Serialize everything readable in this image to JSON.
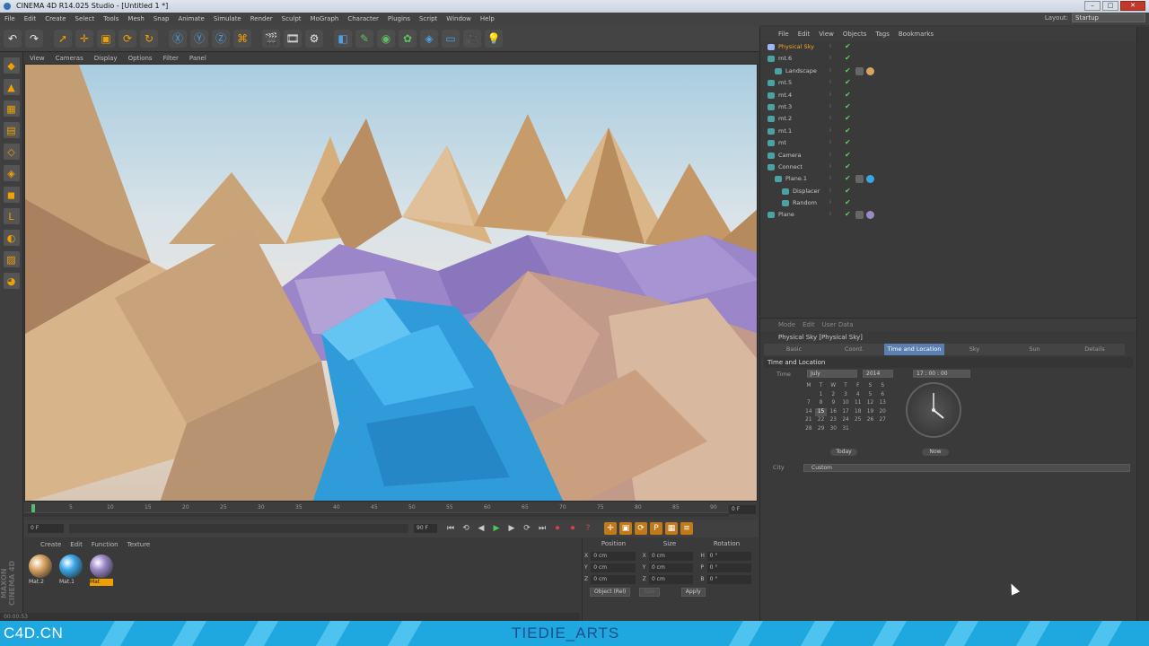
{
  "window": {
    "title": "CINEMA 4D R14.025 Studio - [Untitled 1 *]",
    "min": "–",
    "max": "□",
    "close": "✕"
  },
  "menubar": [
    "File",
    "Edit",
    "Create",
    "Select",
    "Tools",
    "Mesh",
    "Snap",
    "Animate",
    "Simulate",
    "Render",
    "Sculpt",
    "MoGraph",
    "Character",
    "Plugins",
    "Script",
    "Window",
    "Help"
  ],
  "layout": {
    "label": "Layout:",
    "value": "Startup"
  },
  "viewport": {
    "menu": [
      "View",
      "Cameras",
      "Display",
      "Options",
      "Filter",
      "Panel"
    ]
  },
  "timeline": {
    "ticks": [
      "0",
      "5",
      "10",
      "15",
      "20",
      "25",
      "30",
      "35",
      "40",
      "45",
      "50",
      "55",
      "60",
      "65",
      "70",
      "75",
      "80",
      "85",
      "90"
    ],
    "end_frame": "0 F",
    "current_frame": "0 F",
    "min_field": "0 F",
    "max_field": "90 F",
    "range_field": "90 F"
  },
  "materials": {
    "menu": [
      "Create",
      "Edit",
      "Function",
      "Texture"
    ],
    "items": [
      {
        "label": "Mat.2",
        "color": "#d9a460"
      },
      {
        "label": "Mat.1",
        "color": "#3aa6e6"
      },
      {
        "label": "Mat",
        "color": "#9b88c8"
      }
    ]
  },
  "coordinates": {
    "headers": [
      "Position",
      "Size",
      "Rotation"
    ],
    "rows": [
      {
        "axis": "X",
        "pos": "0 cm",
        "size_axis": "X",
        "size": "0 cm",
        "rot_axis": "H",
        "rot": "0 °"
      },
      {
        "axis": "Y",
        "pos": "0 cm",
        "size_axis": "Y",
        "size": "0 cm",
        "rot_axis": "P",
        "rot": "0 °"
      },
      {
        "axis": "Z",
        "pos": "0 cm",
        "size_axis": "Z",
        "size": "0 cm",
        "rot_axis": "B",
        "rot": "0 °"
      }
    ],
    "mode": "Object (Rel)",
    "size_mode": "Size",
    "apply": "Apply"
  },
  "objects": {
    "menu": [
      "File",
      "Edit",
      "View",
      "Objects",
      "Tags",
      "Bookmarks"
    ],
    "items": [
      {
        "name": "Physical Sky",
        "indent": 0,
        "highlight": true,
        "tag": ""
      },
      {
        "name": "mt.6",
        "indent": 0,
        "highlight": false,
        "tag": ""
      },
      {
        "name": "Landscape",
        "indent": 1,
        "highlight": false,
        "tag": "#d9a460"
      },
      {
        "name": "mt.5",
        "indent": 0,
        "highlight": false,
        "tag": ""
      },
      {
        "name": "mt.4",
        "indent": 0,
        "highlight": false,
        "tag": ""
      },
      {
        "name": "mt.3",
        "indent": 0,
        "highlight": false,
        "tag": ""
      },
      {
        "name": "mt.2",
        "indent": 0,
        "highlight": false,
        "tag": ""
      },
      {
        "name": "mt.1",
        "indent": 0,
        "highlight": false,
        "tag": ""
      },
      {
        "name": "mt",
        "indent": 0,
        "highlight": false,
        "tag": ""
      },
      {
        "name": "Camera",
        "indent": 0,
        "highlight": false,
        "tag": ""
      },
      {
        "name": "Connect",
        "indent": 0,
        "highlight": false,
        "tag": ""
      },
      {
        "name": "Plane.1",
        "indent": 1,
        "highlight": false,
        "tag": "#3aa6e6"
      },
      {
        "name": "Displacer",
        "indent": 2,
        "highlight": false,
        "tag": ""
      },
      {
        "name": "Random",
        "indent": 2,
        "highlight": false,
        "tag": ""
      },
      {
        "name": "Plane",
        "indent": 0,
        "highlight": false,
        "tag": "#9b88c8"
      }
    ]
  },
  "attributes": {
    "menu": [
      "Mode",
      "Edit",
      "User Data"
    ],
    "title": "Physical Sky [Physical Sky]",
    "tabs": [
      "Basic",
      "Coord.",
      "Time and Location",
      "Sky",
      "Sun",
      "Details"
    ],
    "active_tab": "Time and Location",
    "section": "Time and Location",
    "time_label": "Time",
    "month": "July",
    "year": "2014",
    "time_value": "17 : 00 : 00",
    "calendar": {
      "days": [
        "M",
        "T",
        "W",
        "T",
        "F",
        "S",
        "S"
      ],
      "weeks": [
        [
          "",
          "1",
          "2",
          "3",
          "4",
          "5",
          "6"
        ],
        [
          "7",
          "8",
          "9",
          "10",
          "11",
          "12",
          "13"
        ],
        [
          "14",
          "15",
          "16",
          "17",
          "18",
          "19",
          "20"
        ],
        [
          "21",
          "22",
          "23",
          "24",
          "25",
          "26",
          "27"
        ],
        [
          "28",
          "29",
          "30",
          "31",
          "",
          "",
          ""
        ]
      ]
    },
    "today_button": "Today",
    "now_button": "Now",
    "city_label": "City",
    "city_value": "Custom"
  },
  "status": {
    "text": "00:00:53"
  },
  "footer": {
    "left": "C4D.CN",
    "center": "TIEDIE_ARTS"
  }
}
